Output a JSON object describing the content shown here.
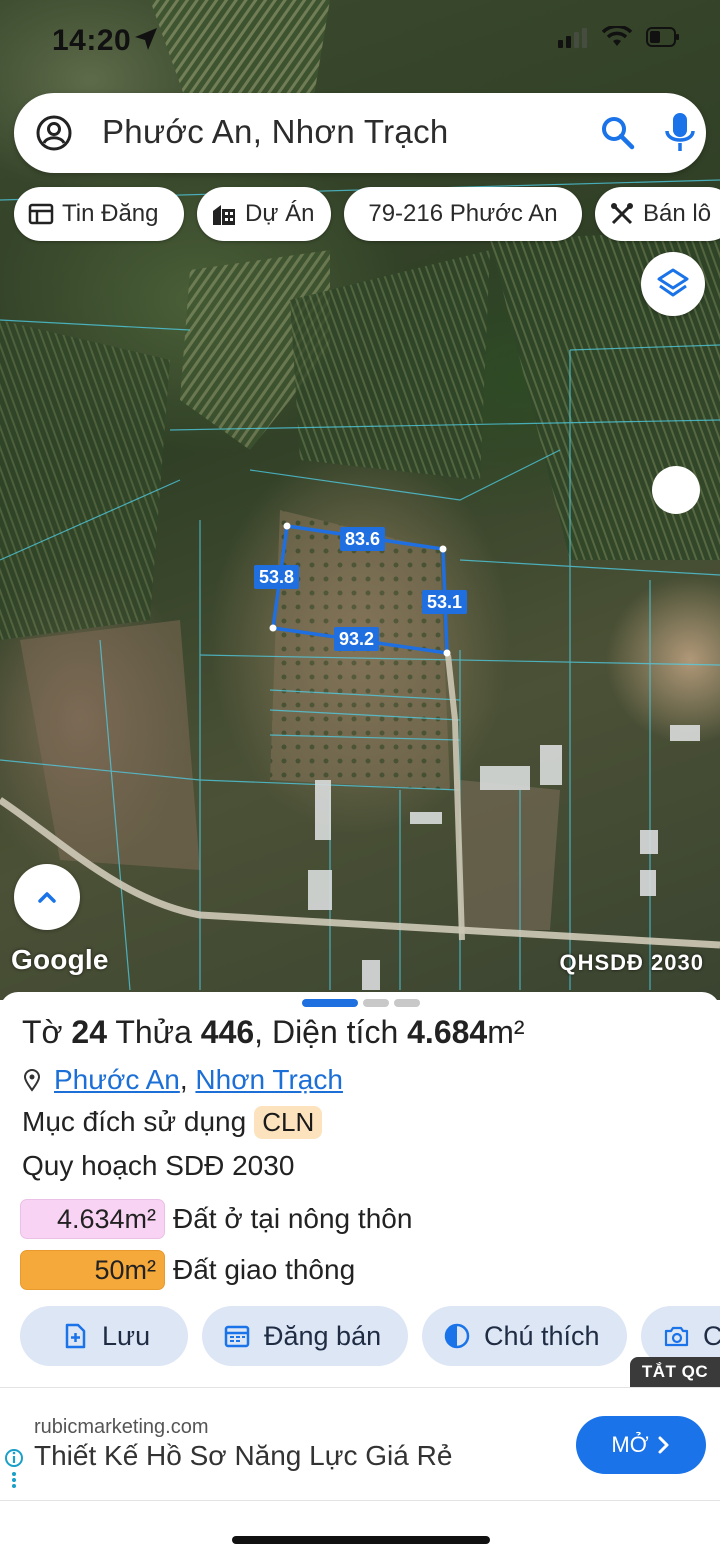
{
  "status_bar": {
    "time": "14:20"
  },
  "search": {
    "query": "Phước An, Nhơn Trạch"
  },
  "chips": [
    {
      "label": "Tin Đăng",
      "icon": "listing-icon"
    },
    {
      "label": "Dự Án",
      "icon": "building-icon"
    },
    {
      "label": "79-216 Phước An",
      "icon": ""
    },
    {
      "label": "Bán lô",
      "icon": "tools-icon"
    }
  ],
  "map": {
    "google_label": "Google",
    "overlay_label": "QHSDĐ 2030",
    "measurements": {
      "top": "83.6",
      "left": "53.8",
      "right": "53.1",
      "bottom": "93.2"
    },
    "parcel_color": "#1f6fe0"
  },
  "sheet": {
    "title": {
      "pre": "Tờ ",
      "sheet_no": "24",
      "mid1": " Thửa ",
      "plot_no": "446",
      "mid2": ", Diện tích ",
      "area": "4.684",
      "unit": "m²"
    },
    "location": {
      "ward": "Phước An",
      "separator": ",",
      "district": "Nhơn Trạch"
    },
    "purpose": {
      "label": "Mục đích sử dụng",
      "code": "CLN"
    },
    "plan": {
      "label": "Quy hoạch SDĐ 2030"
    },
    "zones": [
      {
        "area": "4.634m²",
        "name": "Đất ở tại nông thôn",
        "color": "#f9d3f4",
        "border": "#eac0e6"
      },
      {
        "area": "50m²",
        "name": "Đất giao thông",
        "color": "#f6a93b",
        "border": "#e89a2c"
      }
    ],
    "actions": [
      {
        "label": "Lưu",
        "icon": "save-doc-icon"
      },
      {
        "label": "Đăng bán",
        "icon": "calendar-icon"
      },
      {
        "label": "Chú thích",
        "icon": "half-circle-icon"
      },
      {
        "label": "C",
        "icon": "camera-icon"
      }
    ]
  },
  "ad": {
    "close_label": "TẮT QC",
    "domain": "rubicmarketing.com",
    "headline": "Thiết Kế Hồ Sơ Năng Lực Giá Rẻ",
    "cta": "MỞ"
  }
}
